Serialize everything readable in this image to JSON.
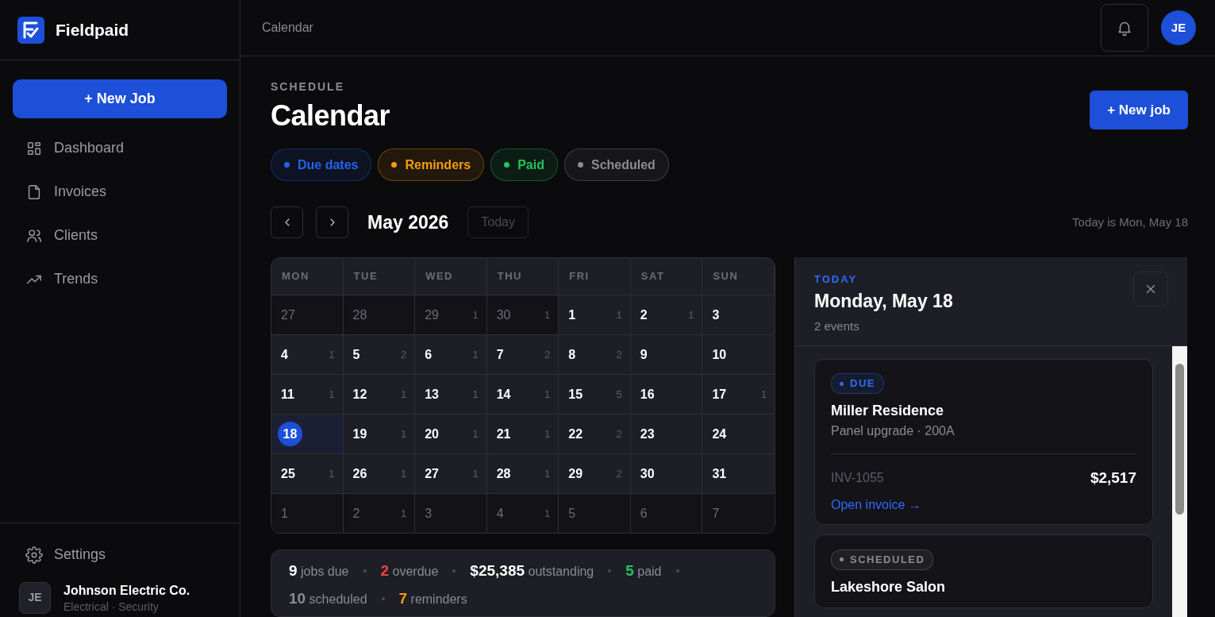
{
  "brand": {
    "name": "Fieldpaid"
  },
  "sidebar": {
    "new_button": "+ New Job",
    "items": [
      {
        "label": "Dashboard",
        "kind": "grid",
        "selected": false
      },
      {
        "label": "Invoices",
        "kind": "file",
        "selected": false
      },
      {
        "label": "Clients",
        "kind": "users",
        "selected": false
      },
      {
        "label": "Trends",
        "kind": "trend",
        "selected": false
      }
    ],
    "settings": "Settings",
    "account": {
      "initials": "JE",
      "name": "Johnson Electric Co.",
      "subtitle": "Electrical · Security"
    }
  },
  "topbar": {
    "breadcrumb": "Calendar",
    "avatar": "JE"
  },
  "header": {
    "eyebrow": "SCHEDULE",
    "title": "Calendar",
    "new_button": "+ New job"
  },
  "legend": [
    {
      "label": "Due dates",
      "color": "#2563eb"
    },
    {
      "label": "Reminders",
      "color": "#f59e0b"
    },
    {
      "label": "Paid",
      "color": "#22c55e"
    },
    {
      "label": "Scheduled",
      "color": "#8b8b94"
    }
  ],
  "month_nav": {
    "month": "May 2026",
    "today_button": "Today",
    "today_disabled": true,
    "today_text": "Today is Mon, May 18"
  },
  "calendar": {
    "weekdays": [
      "MON",
      "TUE",
      "WED",
      "THU",
      "FRI",
      "SAT",
      "SUN"
    ],
    "weeks": [
      [
        {
          "day": "27",
          "outside": true,
          "selected": false
        },
        {
          "day": "28",
          "outside": true,
          "selected": false
        },
        {
          "day": "29",
          "count": "1",
          "outside": true,
          "selected": false
        },
        {
          "day": "30",
          "count": "1",
          "outside": true,
          "selected": false
        },
        {
          "day": "1",
          "count": "1",
          "outside": false,
          "selected": false
        },
        {
          "day": "2",
          "count": "1",
          "outside": false,
          "selected": false
        },
        {
          "day": "3",
          "outside": false,
          "selected": false
        }
      ],
      [
        {
          "day": "4",
          "count": "1",
          "outside": false,
          "selected": false
        },
        {
          "day": "5",
          "count": "2",
          "outside": false,
          "selected": false
        },
        {
          "day": "6",
          "count": "1",
          "outside": false,
          "selected": false
        },
        {
          "day": "7",
          "count": "2",
          "outside": false,
          "selected": false
        },
        {
          "day": "8",
          "count": "2",
          "outside": false,
          "selected": false
        },
        {
          "day": "9",
          "outside": false,
          "selected": false
        },
        {
          "day": "10",
          "outside": false,
          "selected": false
        }
      ],
      [
        {
          "day": "11",
          "count": "1",
          "outside": false,
          "selected": false
        },
        {
          "day": "12",
          "count": "1",
          "outside": false,
          "selected": false
        },
        {
          "day": "13",
          "count": "1",
          "outside": false,
          "selected": false
        },
        {
          "day": "14",
          "count": "1",
          "outside": false,
          "selected": false
        },
        {
          "day": "15",
          "count": "5",
          "outside": false,
          "selected": false
        },
        {
          "day": "16",
          "outside": false,
          "selected": false
        },
        {
          "day": "17",
          "count": "1",
          "outside": false,
          "selected": false
        }
      ],
      [
        {
          "day": "18",
          "outside": false,
          "selected": true
        },
        {
          "day": "19",
          "count": "1",
          "outside": false,
          "selected": false
        },
        {
          "day": "20",
          "count": "1",
          "outside": false,
          "selected": false
        },
        {
          "day": "21",
          "count": "1",
          "outside": false,
          "selected": false
        },
        {
          "day": "22",
          "count": "2",
          "outside": false,
          "selected": false
        },
        {
          "day": "23",
          "outside": false,
          "selected": false
        },
        {
          "day": "24",
          "outside": false,
          "selected": false
        }
      ],
      [
        {
          "day": "25",
          "count": "1",
          "outside": false,
          "selected": false
        },
        {
          "day": "26",
          "count": "1",
          "outside": false,
          "selected": false
        },
        {
          "day": "27",
          "count": "1",
          "outside": false,
          "selected": false
        },
        {
          "day": "28",
          "count": "1",
          "outside": false,
          "selected": false
        },
        {
          "day": "29",
          "count": "2",
          "outside": false,
          "selected": false
        },
        {
          "day": "30",
          "outside": false,
          "selected": false
        },
        {
          "day": "31",
          "outside": false,
          "selected": false
        }
      ],
      [
        {
          "day": "1",
          "outside": true,
          "selected": false
        },
        {
          "day": "2",
          "count": "1",
          "outside": true,
          "selected": false
        },
        {
          "day": "3",
          "outside": true,
          "selected": false
        },
        {
          "day": "4",
          "count": "1",
          "outside": true,
          "selected": false
        },
        {
          "day": "5",
          "outside": true,
          "selected": false
        },
        {
          "day": "6",
          "outside": true,
          "selected": false
        },
        {
          "day": "7",
          "outside": true,
          "selected": false
        }
      ]
    ]
  },
  "stats": [
    {
      "value": "9",
      "label": "jobs due",
      "color": "#ffffff"
    },
    {
      "value": "2",
      "label": "overdue",
      "color": "#ef4444"
    },
    {
      "value": "$25,385",
      "label": "outstanding",
      "color": "#ffffff"
    },
    {
      "value": "5",
      "label": "paid",
      "color": "#22c55e"
    },
    {
      "value": "10",
      "label": "scheduled",
      "color": "#8b8b94"
    },
    {
      "value": "7",
      "label": "reminders",
      "color": "#f59e0b"
    }
  ],
  "day_panel": {
    "eyebrow": "TODAY",
    "title": "Monday, May 18",
    "subtitle": "2 events",
    "events": [
      {
        "kind": "due",
        "tag": "DUE",
        "title": "Miller Residence",
        "subtitle": "Panel upgrade · 200A",
        "invoice": "INV-1055",
        "amount": "$2,517",
        "link": "Open invoice →"
      },
      {
        "kind": "scheduled",
        "tag": "SCHEDULED",
        "title": "Lakeshore Salon"
      }
    ]
  }
}
